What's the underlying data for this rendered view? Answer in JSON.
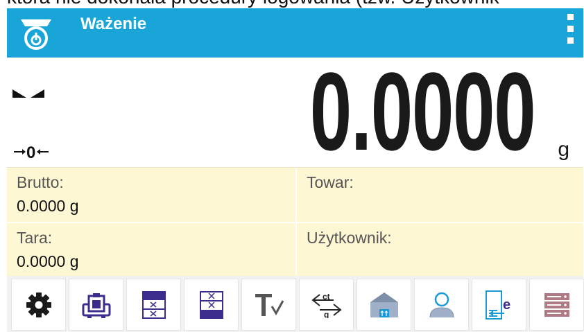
{
  "caption": {
    "text": "która nie dokonała procedury logowania (tzw. Użytkownik"
  },
  "header": {
    "title": "Ważenie",
    "app_icon": "scale-icon",
    "menu_icon": "more-vertical-icon"
  },
  "display": {
    "weight": "0.0000",
    "unit": "g",
    "indicators": [
      "stable-icon",
      "zero-icon"
    ]
  },
  "info": {
    "gross_label": "Brutto:",
    "gross_value": "0.0000 g",
    "tare_label": "Tara:",
    "tare_value": "0.0000 g",
    "product_label": "Towar:",
    "product_value": "",
    "user_label": "Użytkownik:",
    "user_value": ""
  },
  "toolbar": {
    "buttons": [
      "settings-icon",
      "weight-calibration-icon",
      "tare-icon",
      "zero-icon",
      "tara-set-icon",
      "unit-change-icon",
      "product-database-icon",
      "user-icon",
      "export-icon",
      "database-icon"
    ]
  },
  "colors": {
    "header": "#1aa5d9",
    "info_background": "#fdf7d4",
    "icon_purple": "#3c2d8c",
    "icon_blue": "#1b9ad6"
  }
}
